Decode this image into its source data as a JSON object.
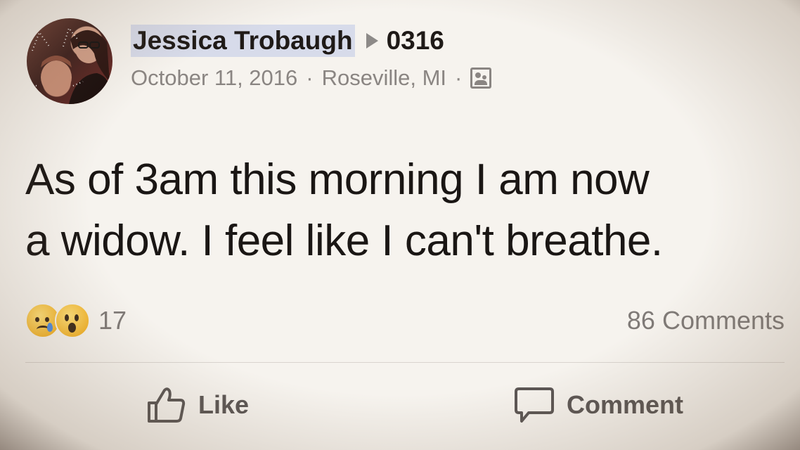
{
  "post": {
    "author": "Jessica Trobaugh",
    "target": "0316",
    "date": "October 11, 2016",
    "separator": "·",
    "location": "Roseville, MI",
    "privacy_icon": "friends-icon",
    "body_line1": "As of 3am this morning I am now",
    "body_line2": "a widow. I feel like I can't breathe."
  },
  "reactions": {
    "icons": [
      "sad-emoji-icon",
      "wow-emoji-icon"
    ],
    "count": "17",
    "comments_label": "86 Comments"
  },
  "actions": {
    "like_label": "Like",
    "comment_label": "Comment"
  },
  "colors": {
    "background": "#f6f3ee",
    "text": "#1a1614",
    "muted": "#8a8582",
    "name_highlight": "#d7dbea",
    "emoji_yellow": "#f3b52e",
    "tear_blue": "#4f8ce0"
  }
}
